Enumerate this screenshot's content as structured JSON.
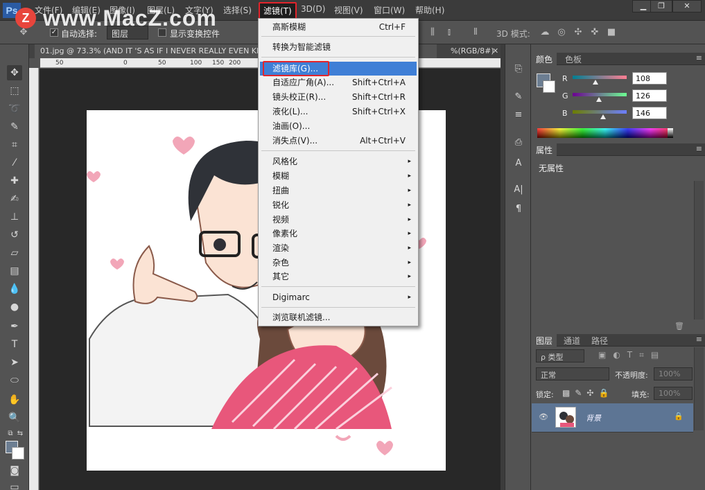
{
  "menubar": {
    "logo": "Ps",
    "items": [
      "文件(F)",
      "编辑(E)",
      "图像(I)",
      "图层(L)",
      "文字(Y)",
      "选择(S)",
      "滤镜(T)",
      "3D(D)",
      "视图(V)",
      "窗口(W)",
      "帮助(H)"
    ],
    "active_index": 6,
    "minimize": "▁",
    "restore": "❐",
    "close": "✕"
  },
  "watermark": {
    "badge": "Z",
    "text": "www.MacZ.com"
  },
  "options_bar": {
    "auto_select_label": "自动选择:",
    "auto_select_value": "图层",
    "show_transform_label": "显示变换控件",
    "mode_3d_label": "3D 模式:"
  },
  "document": {
    "tab_title": "01.jpg @ 73.3% (AND IT 'S  AS IF I NEVER REALLY  EVEN KNE",
    "tab_title_right": "%(RGB/8#)",
    "tab_close": "✕",
    "ruler_ticks": [
      "50",
      "0",
      "50",
      "100",
      "150",
      "200"
    ]
  },
  "filter_menu": {
    "items": [
      {
        "label": "高斯模糊",
        "shortcut": "Ctrl+F"
      },
      {
        "label": "转换为智能滤镜",
        "shortcut": ""
      },
      {
        "label": "滤镜库(G)...",
        "shortcut": ""
      },
      {
        "label": "自适应广角(A)...",
        "shortcut": "Shift+Ctrl+A"
      },
      {
        "label": "镜头校正(R)...",
        "shortcut": "Shift+Ctrl+R"
      },
      {
        "label": "液化(L)...",
        "shortcut": "Shift+Ctrl+X"
      },
      {
        "label": "油画(O)...",
        "shortcut": ""
      },
      {
        "label": "消失点(V)...",
        "shortcut": "Alt+Ctrl+V"
      },
      {
        "label": "风格化",
        "shortcut": ""
      },
      {
        "label": "模糊",
        "shortcut": ""
      },
      {
        "label": "扭曲",
        "shortcut": ""
      },
      {
        "label": "锐化",
        "shortcut": ""
      },
      {
        "label": "视频",
        "shortcut": ""
      },
      {
        "label": "像素化",
        "shortcut": ""
      },
      {
        "label": "渲染",
        "shortcut": ""
      },
      {
        "label": "杂色",
        "shortcut": ""
      },
      {
        "label": "其它",
        "shortcut": ""
      },
      {
        "label": "Digimarc",
        "shortcut": ""
      },
      {
        "label": "浏览联机滤镜...",
        "shortcut": ""
      }
    ],
    "submenu_arrow": "▸"
  },
  "color_panel": {
    "tabs": [
      "颜色",
      "色板"
    ],
    "channels": [
      {
        "label": "R",
        "value": "108",
        "fraction": 0.42
      },
      {
        "label": "G",
        "value": "126",
        "fraction": 0.49
      },
      {
        "label": "B",
        "value": "146",
        "fraction": 0.57
      }
    ],
    "foreground": "#6c7e92",
    "background": "#ffffff"
  },
  "properties_panel": {
    "tab": "属性",
    "empty_text": "无属性"
  },
  "layers_panel": {
    "tabs": [
      "图层",
      "通道",
      "路径"
    ],
    "filter_kind": "ρ 类型",
    "blend_mode": "正常",
    "opacity_label": "不透明度:",
    "opacity_value": "100%",
    "lock_label": "锁定:",
    "fill_label": "填充:",
    "fill_value": "100%",
    "layer_name": "背景"
  },
  "panel_menu_glyph": "≡"
}
